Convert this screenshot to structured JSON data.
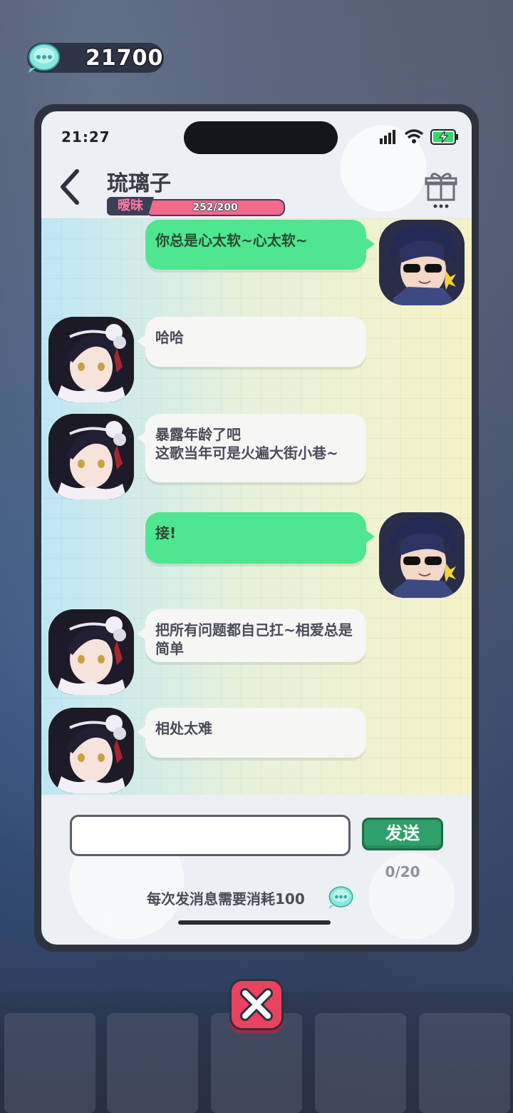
{
  "currency": {
    "value": "21700",
    "icon": "chat-coin-icon"
  },
  "status_bar": {
    "time": "21:27"
  },
  "header": {
    "contact_name": "琉璃子",
    "affection_label": "暧昧",
    "affection_value": "252/200",
    "affection_progress": 1.0
  },
  "messages": [
    {
      "sender": "player",
      "text": "你总是心太软~心太软~"
    },
    {
      "sender": "contact",
      "text": "哈哈"
    },
    {
      "sender": "contact",
      "text": "暴露年龄了吧\n这歌当年可是火遍大街小巷~"
    },
    {
      "sender": "player",
      "text": "接!"
    },
    {
      "sender": "contact",
      "text": "把所有问题都自己扛~相爱总是简单"
    },
    {
      "sender": "contact",
      "text": "相处太难"
    }
  ],
  "input": {
    "value": "",
    "placeholder": ""
  },
  "send_label": "发送",
  "char_count": "0/20",
  "cost_note": "每次发消息需要消耗100",
  "colors": {
    "sent_bubble": "#4ee68e",
    "received_bubble": "#f6f6f5",
    "send_button": "#2fa06a",
    "close_button": "#e94360"
  }
}
